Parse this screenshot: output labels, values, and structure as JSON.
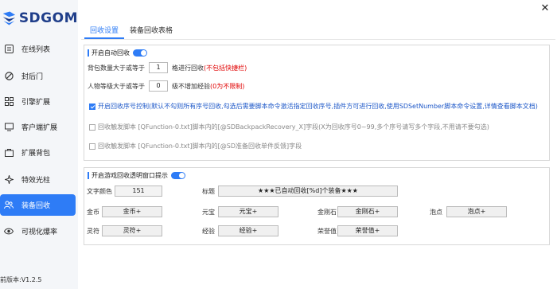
{
  "app": {
    "logo_text": "SDGOM",
    "version": "前版本:V1.2.5",
    "close_symbol": "✕"
  },
  "sidebar": {
    "items": [
      {
        "label": "在线列表",
        "icon": "list-icon"
      },
      {
        "label": "封后门",
        "icon": "ban-icon"
      },
      {
        "label": "引擎扩展",
        "icon": "grid-icon"
      },
      {
        "label": "客户端扩展",
        "icon": "monitor-icon"
      },
      {
        "label": "扩展背包",
        "icon": "bag-icon"
      },
      {
        "label": "特效光柱",
        "icon": "sparkle-icon"
      },
      {
        "label": "装备回收",
        "icon": "people-icon"
      },
      {
        "label": "可视化爆率",
        "icon": "eye-icon"
      }
    ],
    "active_index": 6
  },
  "tabs": [
    {
      "label": "回收设置",
      "active": true
    },
    {
      "label": "装备回收表格",
      "active": false
    }
  ],
  "panel1": {
    "title": "开启自动回收",
    "toggle_on": true,
    "row1": {
      "prefix": "背包数量大于或等于",
      "value": "1",
      "suffix": "格进行回收",
      "note": "(不包括快捷栏)"
    },
    "row2": {
      "prefix": "人物等级大于或等于",
      "value": "0",
      "suffix": "级不增加经验",
      "note": "(0为不限制)"
    },
    "opt1": {
      "checked": true,
      "text": "开启回收序号控制(默认不勾则所有序号回收,勾选后需要脚本命令激活指定回收序号,插件方可进行回收,使用SDSetNumber脚本命令设置,详情查看脚本文档)"
    },
    "opt2": {
      "checked": false,
      "text": "回收触发脚本 [QFunction-0.txt]脚本内的[@SDBackpackRecovery_X]字段(X为回收序号0~99,多个序号请写多个字段,不用请不要勾选)"
    },
    "opt3": {
      "checked": false,
      "text": "回收触发脚本 [QFunction-0.txt]脚本内的[@SD准备回收单件反馈]字段"
    }
  },
  "panel2": {
    "title": "开启游戏回收透明窗口提示",
    "toggle_on": true,
    "text_color_label": "文字颜色",
    "text_color_value": "151",
    "title_label": "标题",
    "title_value": "★★★已自动回收[%d]个装备★★★",
    "fields": [
      {
        "label": "金币",
        "value": "金币+"
      },
      {
        "label": "元宝",
        "value": "元宝+"
      },
      {
        "label": "金刚石",
        "value": "金刚石+"
      },
      {
        "label": "泡点",
        "value": "泡点+"
      },
      {
        "label": "灵符",
        "value": "灵符+"
      },
      {
        "label": "经验",
        "value": "经验+"
      },
      {
        "label": "荣誉值",
        "value": "荣誉值+"
      }
    ]
  },
  "colors": {
    "accent": "#2e7cf6",
    "sidebar_bg": "#f4f6f9",
    "logo": "#1f3e8a",
    "warn": "#e00000"
  }
}
